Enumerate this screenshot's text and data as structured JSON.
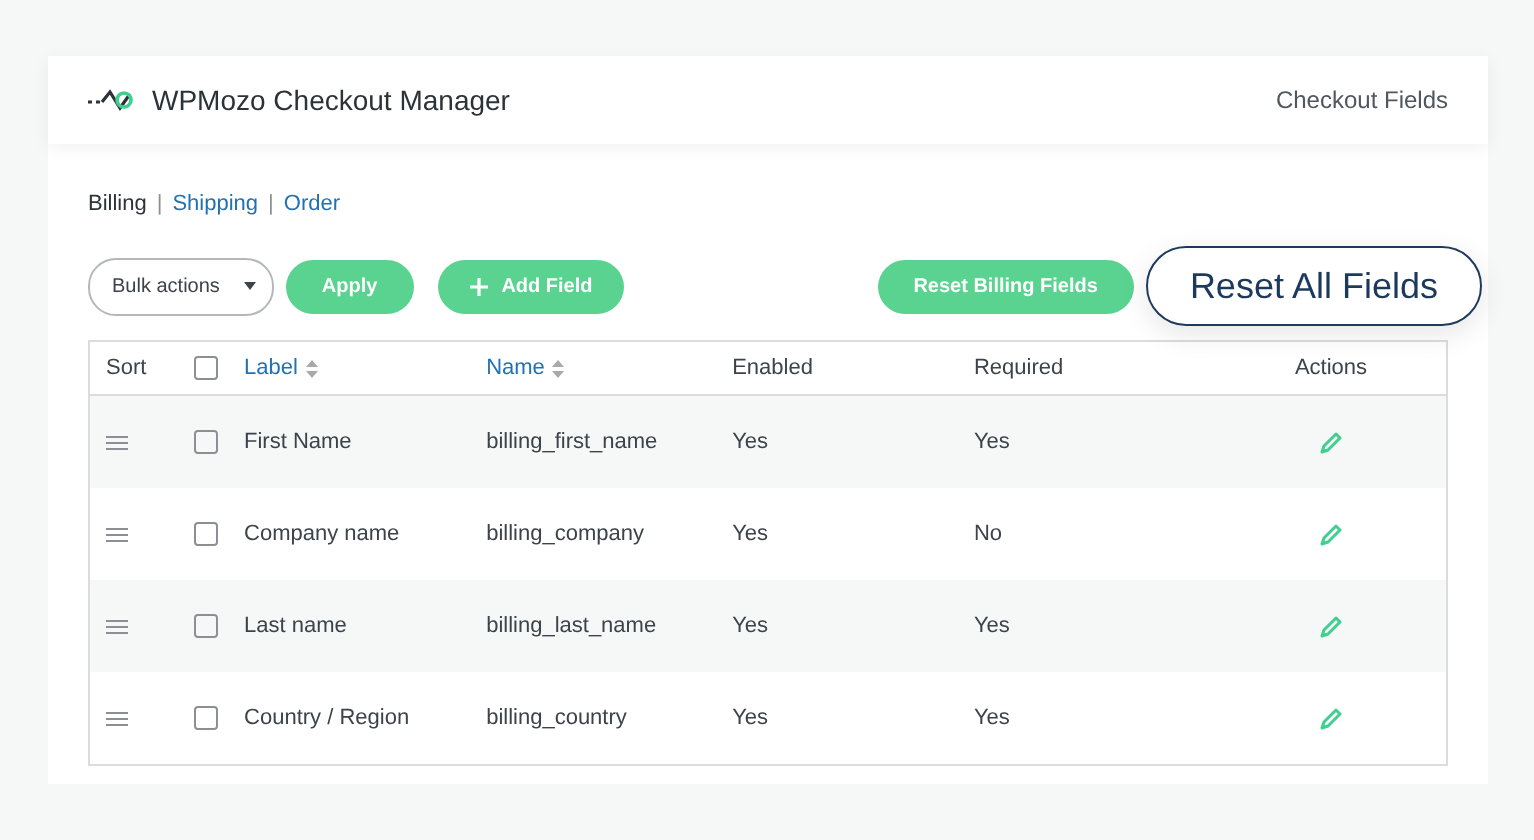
{
  "header": {
    "title": "WPMozo Checkout Manager",
    "link": "Checkout Fields"
  },
  "tabs": [
    {
      "label": "Billing",
      "selected": true
    },
    {
      "label": "Shipping",
      "selected": false
    },
    {
      "label": "Order",
      "selected": false
    }
  ],
  "tab_separators": [
    "|",
    "|"
  ],
  "toolbar": {
    "bulk_actions": "Bulk actions",
    "apply": "Apply",
    "add_field": "Add Field",
    "reset_billing": "Reset Billing Fields",
    "reset_all": "Reset All Fields"
  },
  "table": {
    "columns": [
      {
        "kind": "text",
        "label": "Sort"
      },
      {
        "kind": "checkbox",
        "checked": false
      },
      {
        "kind": "sortable",
        "label": "Label"
      },
      {
        "kind": "sortable",
        "label": "Name"
      },
      {
        "kind": "text",
        "label": "Enabled"
      },
      {
        "kind": "text",
        "label": "Required"
      },
      {
        "kind": "center",
        "label": "Actions"
      }
    ],
    "rows": [
      {
        "checked": false,
        "label": "First Name",
        "name": "billing_first_name",
        "enabled": "Yes",
        "required": "Yes"
      },
      {
        "checked": false,
        "label": "Company name",
        "name": "billing_company",
        "enabled": "Yes",
        "required": "No"
      },
      {
        "checked": false,
        "label": "Last name",
        "name": "billing_last_name",
        "enabled": "Yes",
        "required": "Yes"
      },
      {
        "checked": false,
        "label": "Country / Region",
        "name": "billing_country",
        "enabled": "Yes",
        "required": "Yes"
      }
    ]
  }
}
